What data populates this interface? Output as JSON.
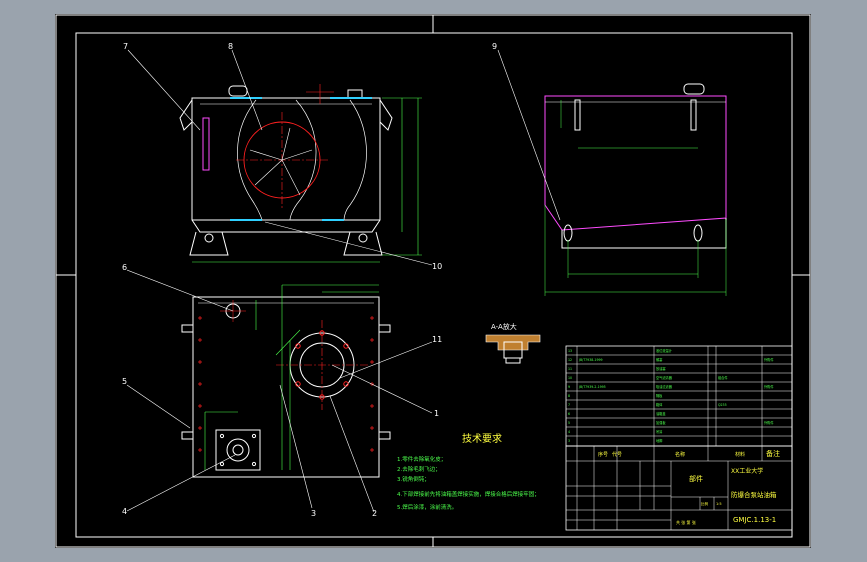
{
  "colors": {
    "sheet": "#000000",
    "outline": "#ffffff",
    "dimension": "#4cff4c",
    "centerline": "#ff2020",
    "magenta": "#ff4cff",
    "cyan": "#30d0ff",
    "yellow": "#ffff40"
  },
  "balloons": {
    "b1": "1",
    "b2": "2",
    "b3": "3",
    "b4": "4",
    "b5": "5",
    "b6": "6",
    "b7": "7",
    "b8": "8",
    "b9": "9",
    "b10": "10",
    "b11": "11"
  },
  "section_label": "A-A放大",
  "tech": {
    "title": "技术要求",
    "items": [
      "1.零件去除氧化皮；",
      "2.去除毛刺飞边；",
      "3.锐角倒钝；",
      "4.下部焊接前先将油箱盖焊接实施，焊接合格后焊接牢固；",
      "5.焊后涂漆，涂前清洗。"
    ]
  },
  "title_block": {
    "part_header": "部件",
    "school": "XX工业大学",
    "drawing_name": "防爆合泵站油箱",
    "drawing_no": "GMJC.1.13-1",
    "col_seq": "序号",
    "col_code": "代号",
    "col_name": "名称",
    "col_material": "材料",
    "col_remark": "备注",
    "scale_label": "比例",
    "scale": "1:5",
    "sheet_label": "共 张 第 张"
  }
}
